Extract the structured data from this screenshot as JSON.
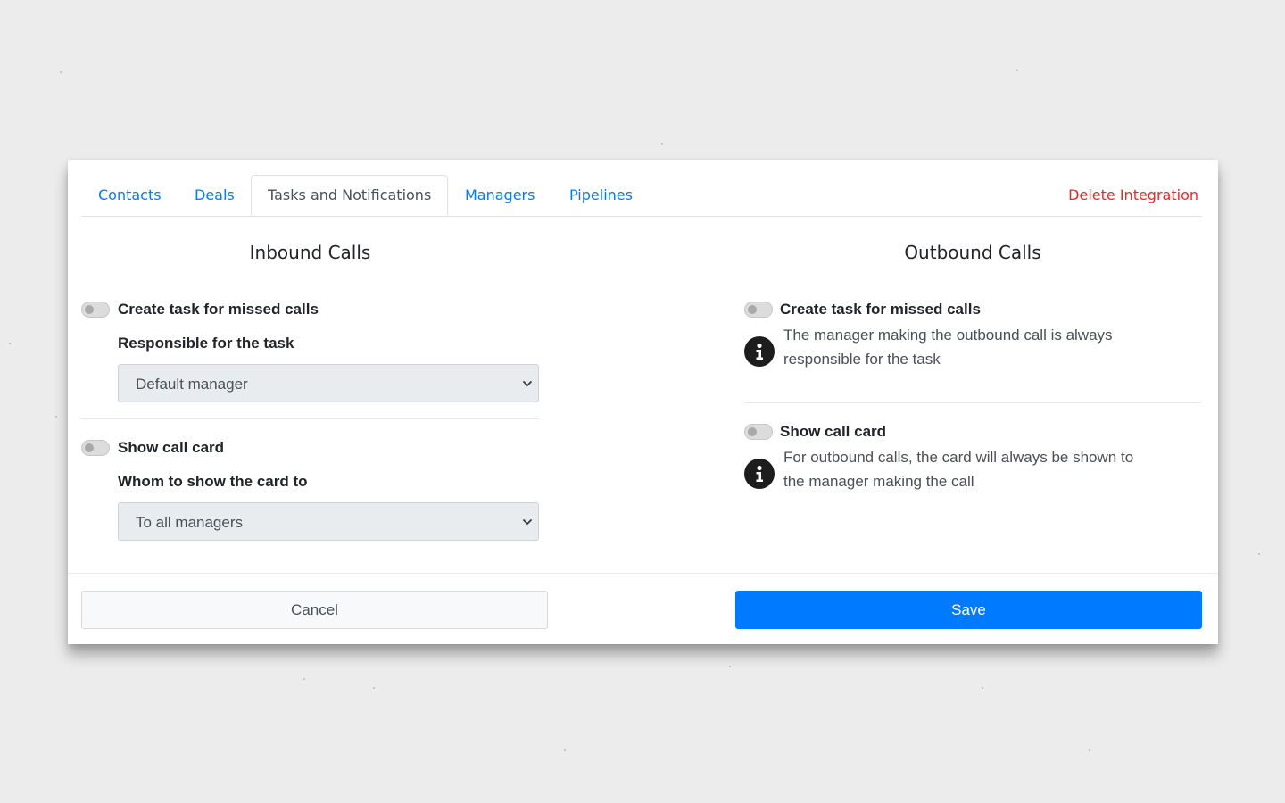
{
  "tabs": [
    {
      "label": "Contacts",
      "active": false
    },
    {
      "label": "Deals",
      "active": false
    },
    {
      "label": "Tasks and Notifications",
      "active": true
    },
    {
      "label": "Managers",
      "active": false
    },
    {
      "label": "Pipelines",
      "active": false
    }
  ],
  "delete_integration": "Delete Integration",
  "inbound": {
    "title": "Inbound Calls",
    "missed_task": {
      "label": "Create task for missed calls",
      "enabled": false,
      "field_label": "Responsible for the task",
      "selected": "Default manager"
    },
    "call_card": {
      "label": "Show call card",
      "enabled": false,
      "field_label": "Whom to show the card to",
      "selected": "To all managers"
    }
  },
  "outbound": {
    "title": "Outbound Calls",
    "missed_task": {
      "label": "Create task for missed calls",
      "enabled": false,
      "note_line1": "The manager making the outbound call is always",
      "note_line2": "responsible for the task"
    },
    "call_card": {
      "label": "Show call card",
      "enabled": false,
      "note_line1": "For outbound calls, the card will always be shown to",
      "note_line2": "the manager making the call"
    }
  },
  "footer": {
    "cancel_label": "Cancel",
    "save_label": "Save"
  },
  "colors": {
    "link": "#007bff",
    "danger": "#ff1f1f",
    "primary_button": "#007bff",
    "backdrop": "#ececec"
  },
  "icons": {
    "info": "info-circle-icon",
    "dropdown": "chevron-down-icon"
  }
}
